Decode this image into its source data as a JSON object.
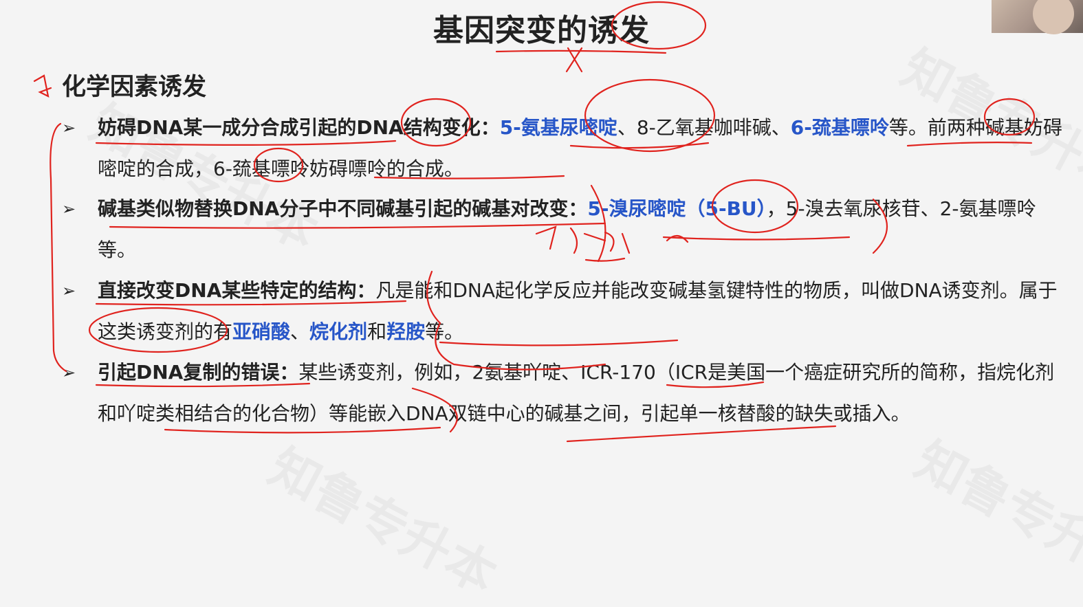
{
  "slide": {
    "title": "基因突变的诱发",
    "section_heading": "化学因素诱发",
    "bullets": [
      {
        "lead": "妨碍DNA某一成分合成引起的DNA结构变化：",
        "blue1": "5-氨基尿嘧啶",
        "mid1": "、8-乙氧基咖啡碱、",
        "blue2": "6-巯基嘌呤",
        "rest": "等。前两种碱基妨碍嘧啶的合成，6-巯基嘌呤妨碍嘌呤的合成。"
      },
      {
        "lead": "碱基类似物替换DNA分子中不同碱基引起的碱基对改变：",
        "blue1": "5-溴尿嘧啶（5-BU）",
        "rest": "，5-溴去氧尿核苷、2-氨基嘌呤等。"
      },
      {
        "lead": "直接改变DNA某些特定的结构：",
        "text1": "凡是能和DNA起化学反应并能改变碱基氢键特性的物质，叫做DNA诱变剂。属于这类诱变剂的有",
        "blue1": "亚硝酸",
        "sep1": "、",
        "blue2": "烷化剂",
        "sep2": "和",
        "blue3": "羟胺",
        "rest": "等。"
      },
      {
        "lead": "引起DNA复制的错误：",
        "text": "某些诱变剂，例如，2氨基吖啶、ICR-170（ICR是美国一个癌症研究所的简称，指烷化剂和吖啶类相结合的化合物）等能嵌入DNA双链中心的碱基之间，引起单一核替酸的缺失或插入。"
      }
    ],
    "bullet_glyph": "➢",
    "watermark": "知鲁专升本"
  },
  "colors": {
    "highlight_blue": "#2756c8",
    "ink_red": "#e0231e",
    "background": "#f4f4f4"
  }
}
